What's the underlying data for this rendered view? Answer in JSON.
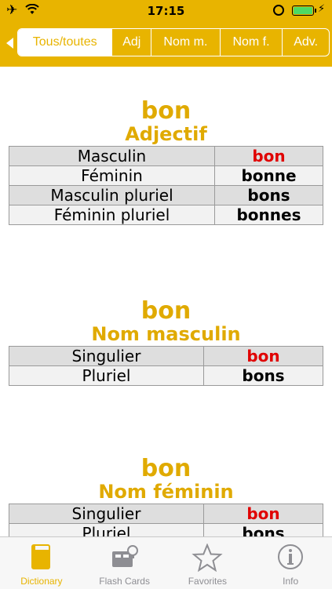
{
  "status_bar": {
    "time": "17:15"
  },
  "filter_tabs": [
    {
      "label": "Tous/toutes",
      "active": true
    },
    {
      "label": "Adj",
      "active": false
    },
    {
      "label": "Nom m.",
      "active": false
    },
    {
      "label": "Nom f.",
      "active": false
    },
    {
      "label": "Adv.",
      "active": false
    }
  ],
  "entries": [
    {
      "word": "bon",
      "pos": "Adjectif",
      "rows": [
        {
          "label": "Masculin",
          "value": "bon",
          "highlight": true
        },
        {
          "label": "Féminin",
          "value": "bonne",
          "highlight": false
        },
        {
          "label": "Masculin pluriel",
          "value": "bons",
          "highlight": false
        },
        {
          "label": "Féminin pluriel",
          "value": "bonnes",
          "highlight": false
        }
      ]
    },
    {
      "word": "bon",
      "pos": "Nom masculin",
      "rows": [
        {
          "label": "Singulier",
          "value": "bon",
          "highlight": true
        },
        {
          "label": "Pluriel",
          "value": "bons",
          "highlight": false
        }
      ]
    },
    {
      "word": "bon",
      "pos": "Nom féminin",
      "rows": [
        {
          "label": "Singulier",
          "value": "bon",
          "highlight": true
        },
        {
          "label": "Pluriel",
          "value": "bons",
          "highlight": false
        }
      ]
    }
  ],
  "tab_bar": [
    {
      "label": "Dictionary",
      "icon": "book-icon",
      "active": true
    },
    {
      "label": "Flash Cards",
      "icon": "flash-cards-icon",
      "active": false
    },
    {
      "label": "Favorites",
      "icon": "star-icon",
      "active": false
    },
    {
      "label": "Info",
      "icon": "info-icon",
      "active": false
    }
  ],
  "colors": {
    "accent": "#e8b400",
    "highlight": "#e00000"
  }
}
